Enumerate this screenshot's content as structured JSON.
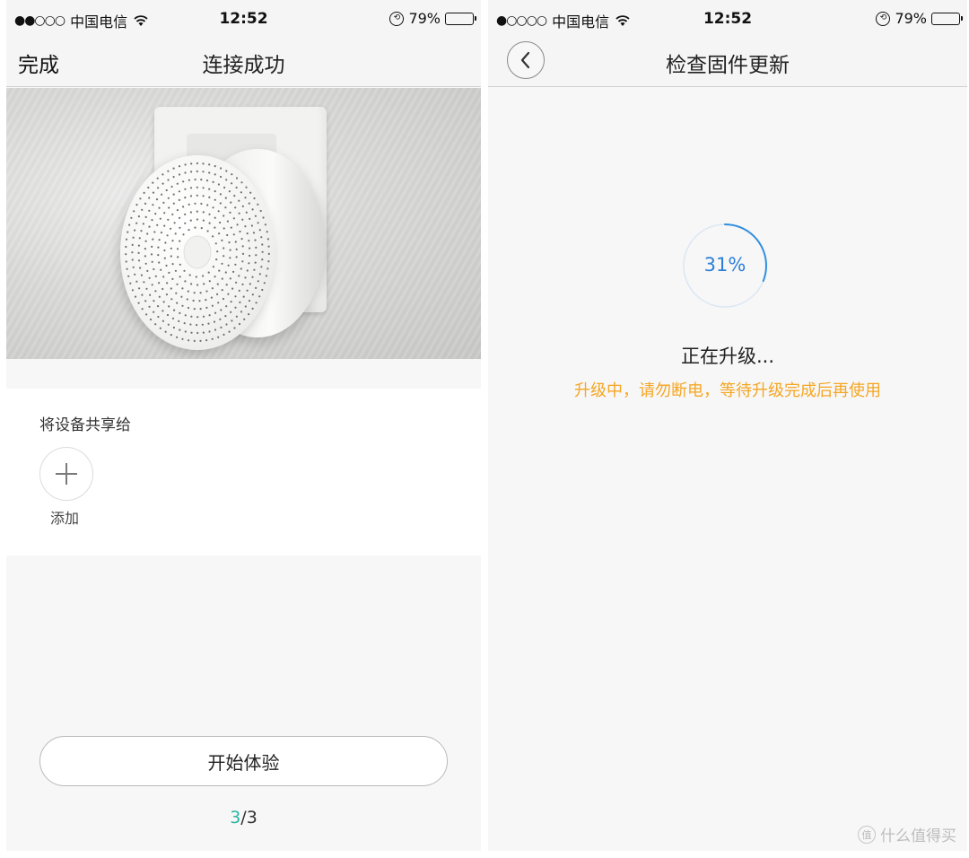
{
  "left": {
    "status": {
      "signal": "●●○○○",
      "carrier": "中国电信",
      "time": "12:52",
      "battery_text": "79%",
      "battery_level": 0.79
    },
    "nav": {
      "done_label": "完成",
      "title": "连接成功"
    },
    "share": {
      "label": "将设备共享给",
      "add_label": "添加"
    },
    "start_button": "开始体验",
    "pager": {
      "current": "3",
      "separator_total": "/3"
    }
  },
  "right": {
    "status": {
      "signal": "●○○○○",
      "carrier": "中国电信",
      "time": "12:52",
      "battery_text": "79%",
      "battery_level": 0.79
    },
    "nav": {
      "title": "检查固件更新"
    },
    "progress": {
      "value": 0.31,
      "text": "31%"
    },
    "status_text": "正在升级...",
    "warning_text": "升级中，请勿断电，等待升级完成后再使用"
  },
  "watermark": {
    "text": "什么值得买",
    "icon_glyph": "值"
  },
  "colors": {
    "accent_teal": "#2bb5a0",
    "progress_blue": "#2f7fd8",
    "warning_orange": "#f5a623"
  }
}
